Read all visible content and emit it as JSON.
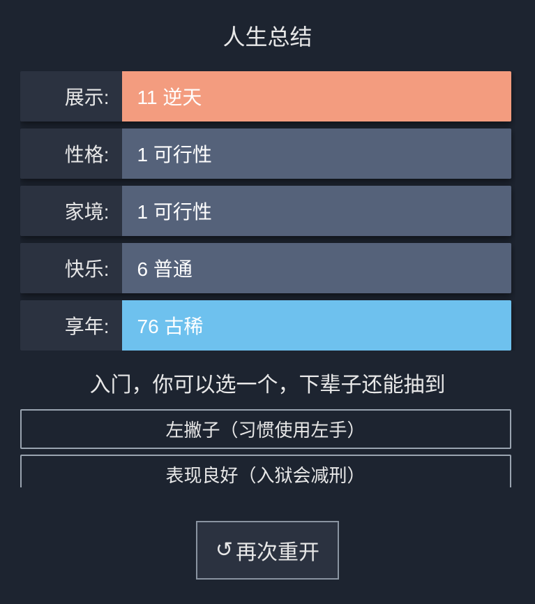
{
  "title": "人生总结",
  "stats": [
    {
      "label": "展示:",
      "value": "11 逆天",
      "variant": "orange"
    },
    {
      "label": "性格:",
      "value": "1 可行性",
      "variant": "slate"
    },
    {
      "label": "家境:",
      "value": "1 可行性",
      "variant": "slate"
    },
    {
      "label": "快乐:",
      "value": "6 普通",
      "variant": "slate"
    },
    {
      "label": "享年:",
      "value": "76 古稀",
      "variant": "blue"
    }
  ],
  "talentPrompt": "入门，你可以选一个，下辈子还能抽到",
  "talents": [
    {
      "text": "左撇子（习惯使用左手）"
    },
    {
      "text": "表现良好（入狱会减刑）"
    }
  ],
  "restartLabel": "再次重开"
}
